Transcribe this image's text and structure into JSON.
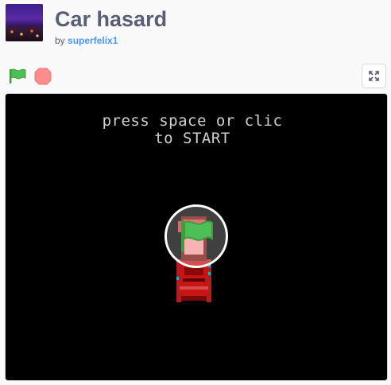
{
  "project": {
    "title": "Car hasard",
    "by_label": "by",
    "author": "superfelix1"
  },
  "controls": {
    "green_flag_icon": "green-flag-icon",
    "stop_icon": "stop-sign-icon",
    "fullscreen_icon": "expand-icon"
  },
  "stage": {
    "line1": "press space or clic",
    "line2": "to START",
    "sprite": "red-car-sprite",
    "overlay_icon": "green-flag-icon"
  },
  "colors": {
    "title": "#575e75",
    "author_link": "#4c97ff",
    "green_flag": "#0fbd8c",
    "stop": "#ff8c8c"
  }
}
